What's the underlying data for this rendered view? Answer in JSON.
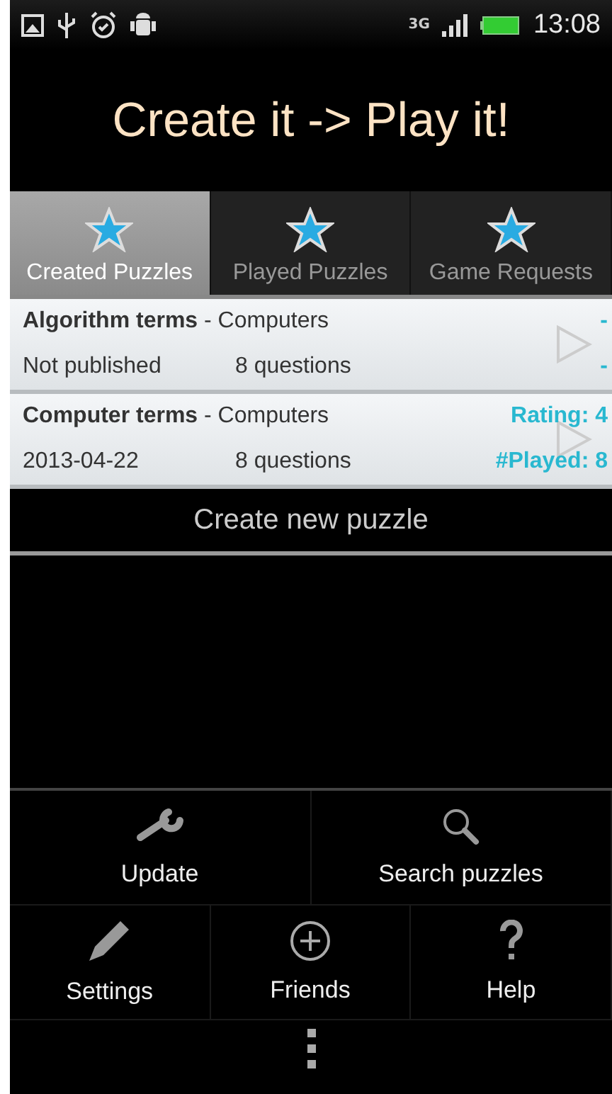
{
  "status_bar": {
    "network": "3G",
    "time": "13:08"
  },
  "title": "Create it -> Play it!",
  "tabs": [
    {
      "label": "Created Puzzles",
      "selected": true
    },
    {
      "label": "Played Puzzles",
      "selected": false
    },
    {
      "label": "Game Requests",
      "selected": false
    }
  ],
  "puzzles": [
    {
      "title": "**Algorithm terms** - Computers",
      "status": "Not published",
      "questions": "8 questions",
      "rating": "-",
      "played": "-"
    },
    {
      "title": "**Computer terms** - Computers",
      "status": "2013-04-22",
      "questions": "8 questions",
      "rating": "Rating: 4",
      "played": "#Played: 8"
    }
  ],
  "create_button": "Create new puzzle",
  "menu": [
    [
      {
        "label": "Update"
      },
      {
        "label": "Search puzzles"
      }
    ],
    [
      {
        "label": "Settings"
      },
      {
        "label": "Friends"
      },
      {
        "label": "Help"
      }
    ]
  ]
}
